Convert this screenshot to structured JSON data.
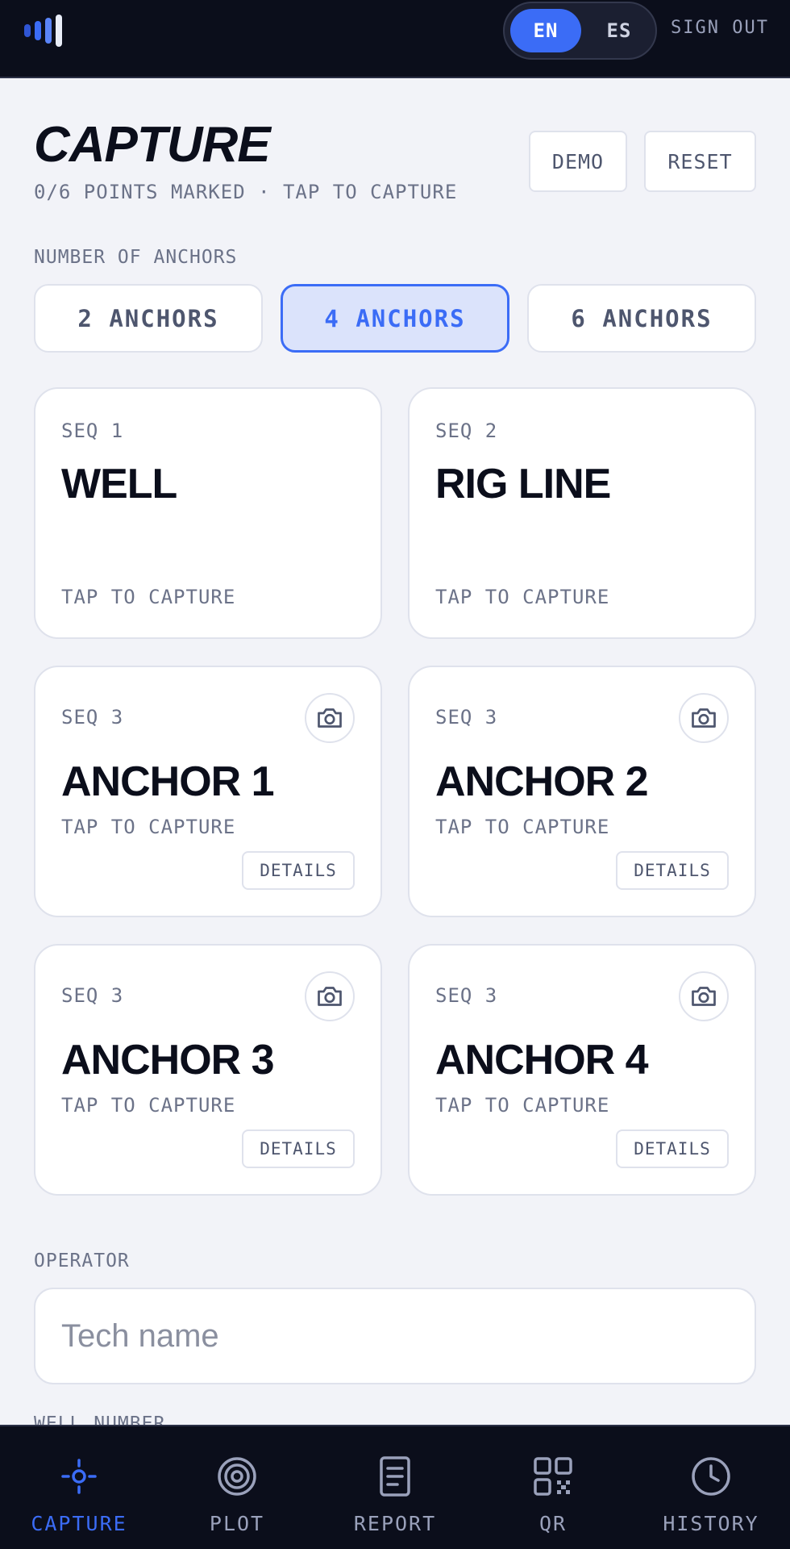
{
  "topbar": {
    "lang_en": "EN",
    "lang_es": "ES",
    "active_lang": "EN",
    "sign_out": "SIGN OUT"
  },
  "header": {
    "title": "CAPTURE",
    "subtitle": "0/6 POINTS MARKED · TAP TO CAPTURE",
    "demo": "DEMO",
    "reset": "RESET"
  },
  "anchors": {
    "label": "NUMBER OF ANCHORS",
    "options": [
      "2 ANCHORS",
      "4 ANCHORS",
      "6 ANCHORS"
    ],
    "selected": "4 ANCHORS"
  },
  "cards": [
    {
      "seq": "SEQ 1",
      "name": "WELL",
      "status": "TAP TO CAPTURE"
    },
    {
      "seq": "SEQ 2",
      "name": "RIG LINE",
      "status": "TAP TO CAPTURE"
    },
    {
      "seq": "SEQ 3",
      "name": "ANCHOR 1",
      "status": "TAP TO CAPTURE",
      "details": "DETAILS"
    },
    {
      "seq": "SEQ 3",
      "name": "ANCHOR 2",
      "status": "TAP TO CAPTURE",
      "details": "DETAILS"
    },
    {
      "seq": "SEQ 3",
      "name": "ANCHOR 3",
      "status": "TAP TO CAPTURE",
      "details": "DETAILS"
    },
    {
      "seq": "SEQ 3",
      "name": "ANCHOR 4",
      "status": "TAP TO CAPTURE",
      "details": "DETAILS"
    }
  ],
  "operator": {
    "label": "OPERATOR",
    "placeholder": "Tech name",
    "value": ""
  },
  "well_number": {
    "label": "WELL NUMBER"
  },
  "nav": [
    {
      "label": "CAPTURE",
      "icon": "crosshair-icon",
      "active": true
    },
    {
      "label": "PLOT",
      "icon": "target-icon",
      "active": false
    },
    {
      "label": "REPORT",
      "icon": "document-icon",
      "active": false
    },
    {
      "label": "QR",
      "icon": "qr-code-icon",
      "active": false
    },
    {
      "label": "HISTORY",
      "icon": "clock-icon",
      "active": false
    }
  ],
  "colors": {
    "accent": "#3b6cf6",
    "dark_bar": "#0b0e1b",
    "background": "#f2f3f8",
    "muted_text": "#6b7288"
  }
}
